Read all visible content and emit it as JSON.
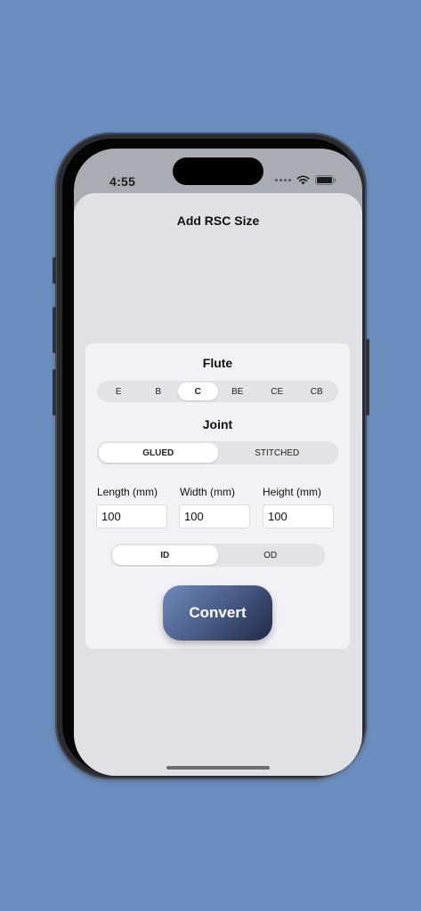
{
  "status_bar": {
    "time": "4:55"
  },
  "sheet": {
    "title": "Add RSC Size"
  },
  "flute": {
    "label": "Flute",
    "options": [
      "E",
      "B",
      "C",
      "BE",
      "CE",
      "CB"
    ],
    "selected": "C"
  },
  "joint": {
    "label": "Joint",
    "options": [
      "GLUED",
      "STITCHED"
    ],
    "selected": "GLUED"
  },
  "dimensions": {
    "length_label": "Length (mm)",
    "length_value": "100",
    "width_label": "Width (mm)",
    "width_value": "100",
    "height_label": "Height (mm)",
    "height_value": "100"
  },
  "measure": {
    "options": [
      "ID",
      "OD"
    ],
    "selected": "ID"
  },
  "convert_label": "Convert",
  "colors": {
    "background": "#6b8ebf",
    "sheet": "#dfe1e5",
    "card": "#f1f1f6",
    "button_gradient_start": "#6e8abb",
    "button_gradient_end": "#1f2947"
  }
}
